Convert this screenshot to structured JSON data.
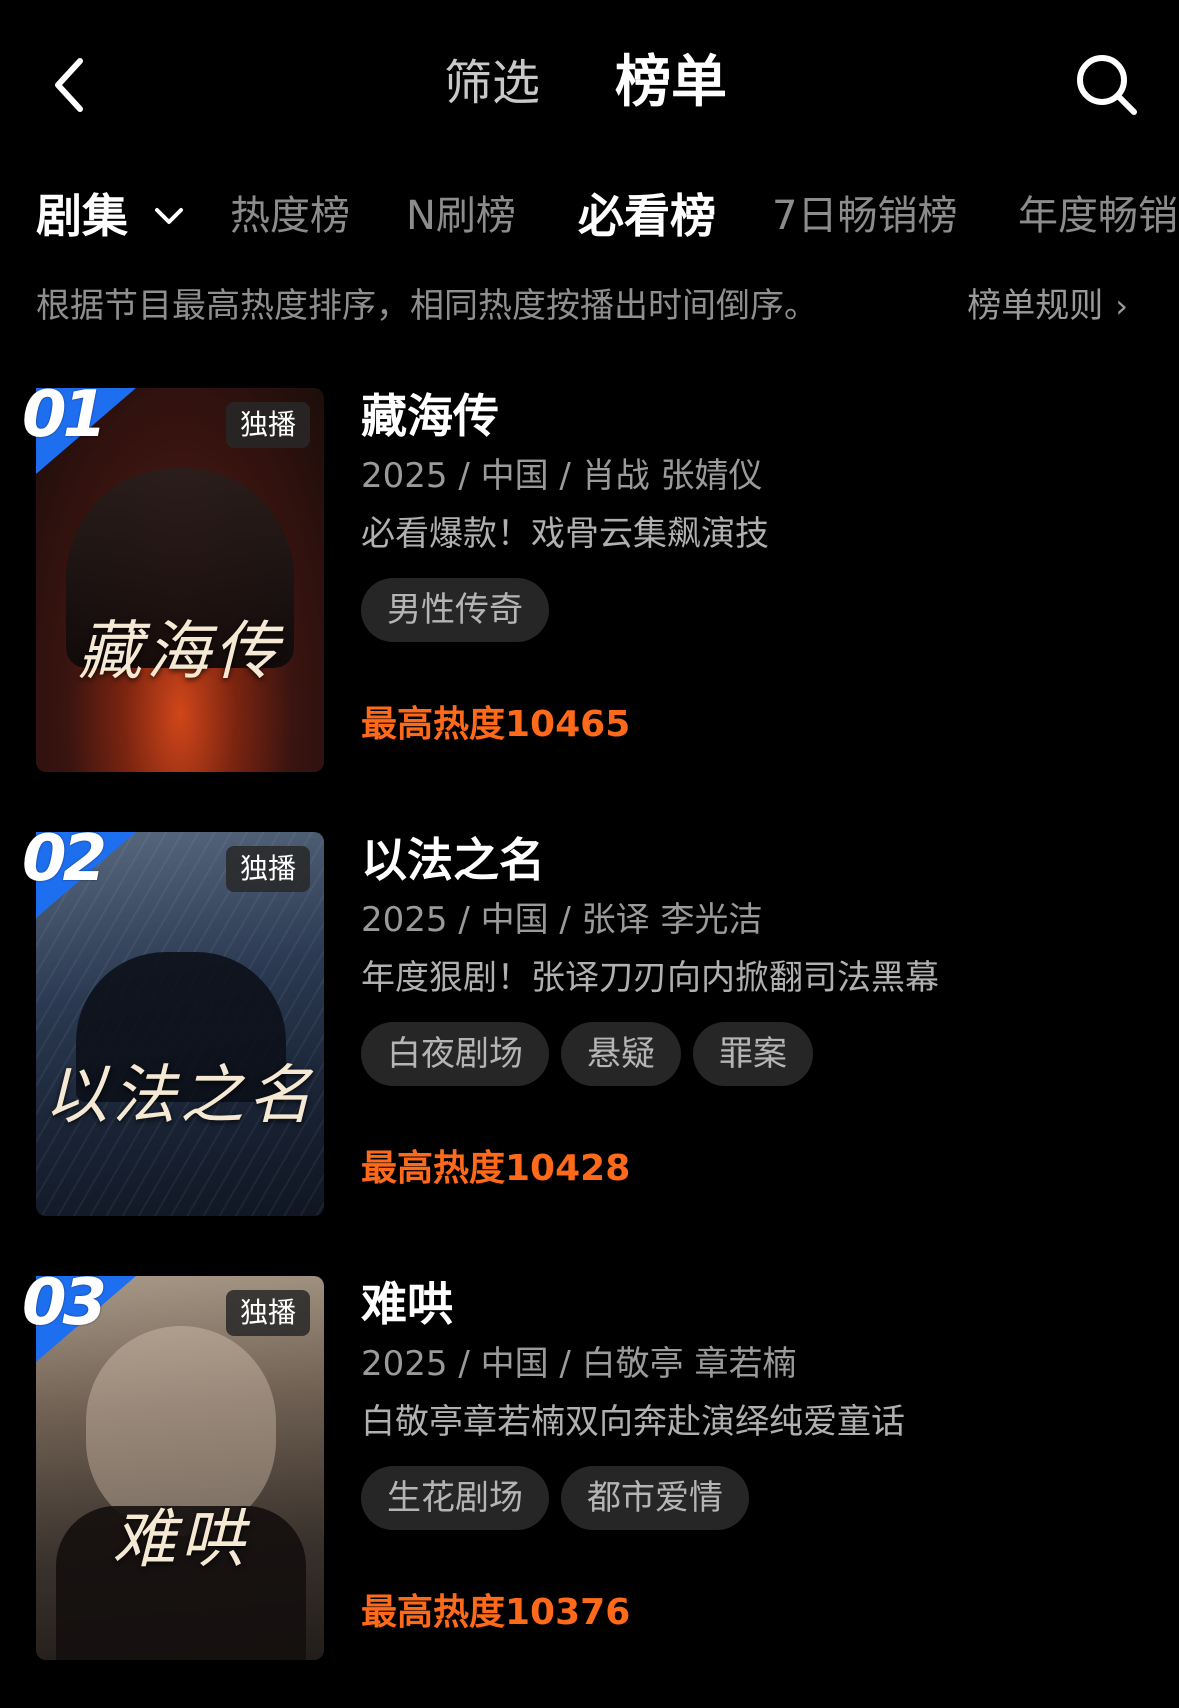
{
  "header": {
    "filter_label": "筛选",
    "rank_label": "榜单"
  },
  "categories": {
    "main": "剧集",
    "tabs": [
      "热度榜",
      "N刷榜",
      "必看榜",
      "7日畅销榜",
      "年度畅销"
    ],
    "active": "必看榜"
  },
  "description": {
    "text": "根据节目最高热度排序，相同热度按播出时间倒序。",
    "rules_label": "榜单规则"
  },
  "colors": {
    "background": "#000000",
    "accent_orange": "#ff6a1a",
    "rank_blue": "#1e6ff0",
    "tag_bg": "#262626"
  },
  "items": [
    {
      "rank": "01",
      "badge": "独播",
      "title": "藏海传",
      "poster_title": "藏海传",
      "meta": "2025 / 中国 / 肖战 张婧仪",
      "slogan": "必看爆款！戏骨云集飙演技",
      "tags": [
        "男性传奇"
      ],
      "heat": "最高热度10465"
    },
    {
      "rank": "02",
      "badge": "独播",
      "title": "以法之名",
      "poster_title": "以法之名",
      "meta": "2025 / 中国 / 张译 李光洁",
      "slogan": "年度狠剧！张译刀刃向内掀翻司法黑幕",
      "tags": [
        "白夜剧场",
        "悬疑",
        "罪案"
      ],
      "heat": "最高热度10428"
    },
    {
      "rank": "03",
      "badge": "独播",
      "title": "难哄",
      "poster_title": "难哄",
      "meta": "2025 / 中国 / 白敬亭 章若楠",
      "slogan": "白敬亭章若楠双向奔赴演绎纯爱童话",
      "tags": [
        "生花剧场",
        "都市爱情"
      ],
      "heat": "最高热度10376"
    }
  ]
}
